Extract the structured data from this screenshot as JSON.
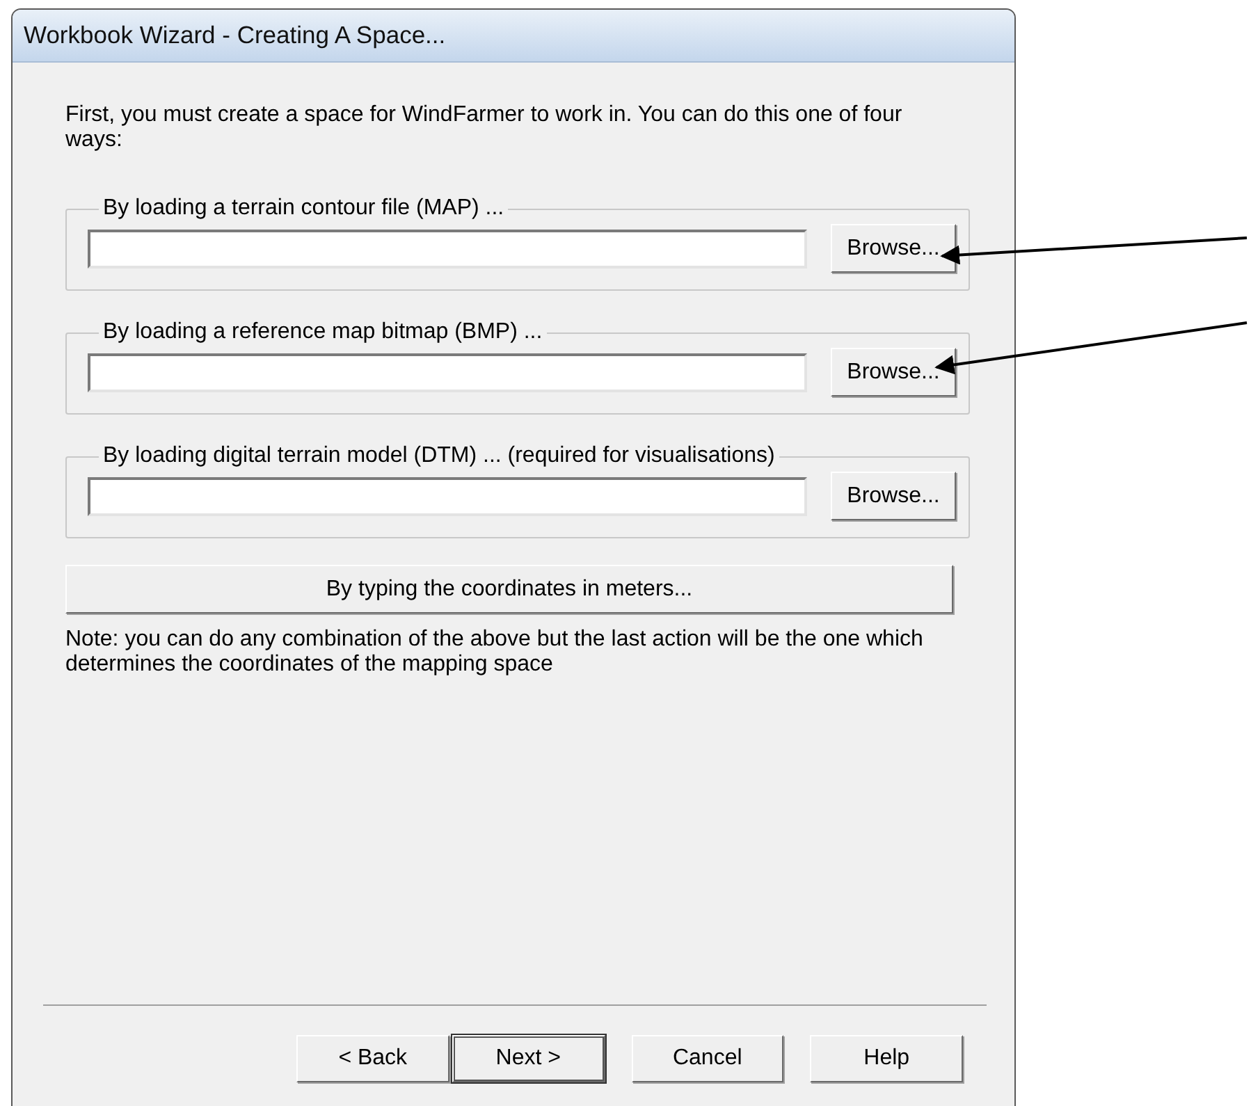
{
  "window": {
    "title": "Workbook Wizard - Creating A Space..."
  },
  "intro": "First, you must create a space for WindFarmer to work in. You can do this one of four ways:",
  "groups": [
    {
      "label": "By loading a terrain contour file (MAP) ...",
      "button": "Browse...",
      "annotated": true
    },
    {
      "label": "By loading a reference map bitmap (BMP) ...",
      "button": "Browse...",
      "annotated": true
    },
    {
      "label": "By loading digital terrain model (DTM) ...    (required for visualisations)",
      "button": "Browse...",
      "annotated": false
    }
  ],
  "coordinates_button": "By typing the coordinates in meters...",
  "note": "Note: you can do any combination of the above but the last action will be the one which determines the coordinates of the mapping space",
  "buttons": [
    {
      "label": "< Back",
      "default": false
    },
    {
      "label": "Next >",
      "default": true
    },
    {
      "label": "Cancel",
      "default": false
    },
    {
      "label": "Help",
      "default": false
    }
  ]
}
